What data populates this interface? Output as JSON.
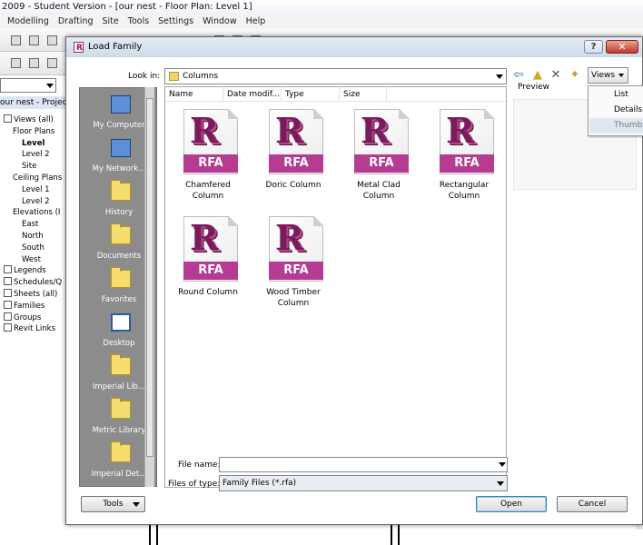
{
  "app": {
    "title": "2009 - Student Version - [our nest - Floor Plan: Level 1]",
    "menu": [
      "Modelling",
      "Drafting",
      "Site",
      "Tools",
      "Settings",
      "Window",
      "Help"
    ]
  },
  "project_browser": {
    "header": "our nest - Project br",
    "items": [
      {
        "label": "Views (all)",
        "indent": 0
      },
      {
        "label": "Floor Plans",
        "indent": 1
      },
      {
        "label": "Level",
        "indent": 2,
        "bold": true
      },
      {
        "label": "Level 2",
        "indent": 2
      },
      {
        "label": "Site",
        "indent": 2
      },
      {
        "label": "Ceiling Plans",
        "indent": 1
      },
      {
        "label": "Level 1",
        "indent": 2
      },
      {
        "label": "Level 2",
        "indent": 2
      },
      {
        "label": "Elevations (I",
        "indent": 1
      },
      {
        "label": "East",
        "indent": 2
      },
      {
        "label": "North",
        "indent": 2
      },
      {
        "label": "South",
        "indent": 2
      },
      {
        "label": "West",
        "indent": 2
      },
      {
        "label": "Legends",
        "indent": 0
      },
      {
        "label": "Schedules/Q",
        "indent": 0
      },
      {
        "label": "Sheets (all)",
        "indent": 0
      },
      {
        "label": "Families",
        "indent": 0
      },
      {
        "label": "Groups",
        "indent": 0
      },
      {
        "label": "Revit Links",
        "indent": 0
      }
    ]
  },
  "dialog": {
    "title": "Load Family",
    "help_label": "?",
    "close_label": "✕",
    "look_in_label": "Look in:",
    "look_in_value": "Columns",
    "preview_label": "Preview",
    "views_label": "Views",
    "views_menu": [
      "List",
      "Details",
      "Thumbnails"
    ],
    "places": [
      "My Computer",
      "My Network...",
      "History",
      "Documents",
      "Favorites",
      "Desktop",
      "Imperial Lib...",
      "Metric Library",
      "Imperial Det..."
    ],
    "columns": [
      "Name",
      "Date modif...",
      "Type",
      "Size"
    ],
    "files": [
      {
        "name": "Chamfered Column",
        "line1": "Chamfered",
        "line2": "Column"
      },
      {
        "name": "Doric Column",
        "line1": "Doric Column",
        "line2": ""
      },
      {
        "name": "Metal Clad Column",
        "line1": "Metal Clad",
        "line2": "Column"
      },
      {
        "name": "Rectangular Column",
        "line1": "Rectangular",
        "line2": "Column"
      },
      {
        "name": "Round Column",
        "line1": "Round Column",
        "line2": ""
      },
      {
        "name": "Wood Timber Column",
        "line1": "Wood Timber",
        "line2": "Column"
      }
    ],
    "rfa_badge": "RFA",
    "file_name_label": "File name:",
    "file_name_value": "",
    "files_of_type_label": "Files of type:",
    "files_of_type_value": "Family Files  (*.rfa)",
    "tools_label": "Tools",
    "open_label": "Open",
    "cancel_label": "Cancel"
  }
}
